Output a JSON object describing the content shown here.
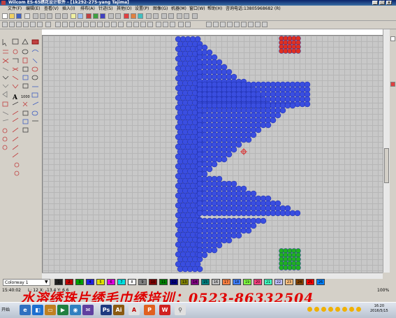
{
  "window": {
    "title": "Wilcom ES-65绣花设计软件 - [1k292-275-yang           Tajima]"
  },
  "menu": {
    "items": [
      "文件(F)",
      "编辑(E)",
      "查看(V)",
      "插入(I)",
      "排布(A)",
      "针迹(S)",
      "其他(O)",
      "设置(P)",
      "图像(G)",
      "机器(M)",
      "窗口(W)",
      "帮助(H)"
    ],
    "extra": "咨询电话:13805968682 (R)"
  },
  "colorway": {
    "value": "Colorway 1"
  },
  "palette": {
    "colors": [
      "#202020",
      "#c00000",
      "#00a000",
      "#2020e0",
      "#e0e000",
      "#e000e0",
      "#00e0e0",
      "#ffffff",
      "#808080",
      "#800000",
      "#008000",
      "#000080",
      "#808000",
      "#800080",
      "#008080",
      "#c0c0c0",
      "#ff8040",
      "#4080ff",
      "#80ff40",
      "#ff4080",
      "#40ffc0",
      "#c0c0ff",
      "#ffc080",
      "#804000",
      "#ff0000",
      "#0080ff"
    ],
    "labels": [
      "1",
      "2",
      "3",
      "4",
      "5",
      "6",
      "7",
      "8",
      "9",
      "10",
      "11",
      "12",
      "13",
      "14",
      "15",
      "16",
      "17",
      "18",
      "19",
      "20",
      "21",
      "22",
      "23",
      "24",
      "25",
      "26"
    ]
  },
  "status": {
    "left": "15:40:02",
    "coords": "L: 12 X: -13.4 Y: 6.6",
    "right_value": "100%"
  },
  "banner": {
    "text": "水溶绣珠片绣毛巾绣培训：0523-86332504"
  },
  "taskbar": {
    "start_label": "开始",
    "time": "16:20",
    "date": "2016/5/15"
  },
  "colors": {
    "design_blue": "#3a4ee0",
    "design_red": "#e03020",
    "design_green": "#20b020",
    "banner_red": "#e00000"
  }
}
